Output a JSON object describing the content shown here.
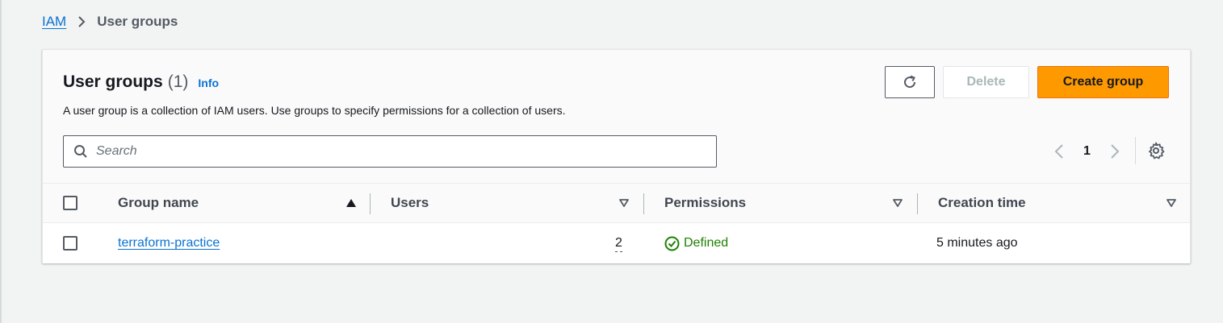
{
  "breadcrumb": {
    "root": "IAM",
    "current": "User groups"
  },
  "panel": {
    "title": "User groups",
    "count": "(1)",
    "info": "Info",
    "description": "A user group is a collection of IAM users. Use groups to specify permissions for a collection of users."
  },
  "actions": {
    "refresh_icon": "refresh-icon",
    "delete_label": "Delete",
    "create_label": "Create group"
  },
  "search": {
    "placeholder": "Search",
    "value": ""
  },
  "pagination": {
    "current_page": "1"
  },
  "table": {
    "columns": [
      "Group name",
      "Users",
      "Permissions",
      "Creation time"
    ],
    "sorted_column": "Group name",
    "rows": [
      {
        "group_name": "terraform-practice",
        "users": "2",
        "permissions": "Defined",
        "creation_time": "5 minutes ago"
      }
    ]
  },
  "colors": {
    "accent": "#0972d3",
    "primary_button": "#ff9900",
    "success": "#1d8102"
  }
}
